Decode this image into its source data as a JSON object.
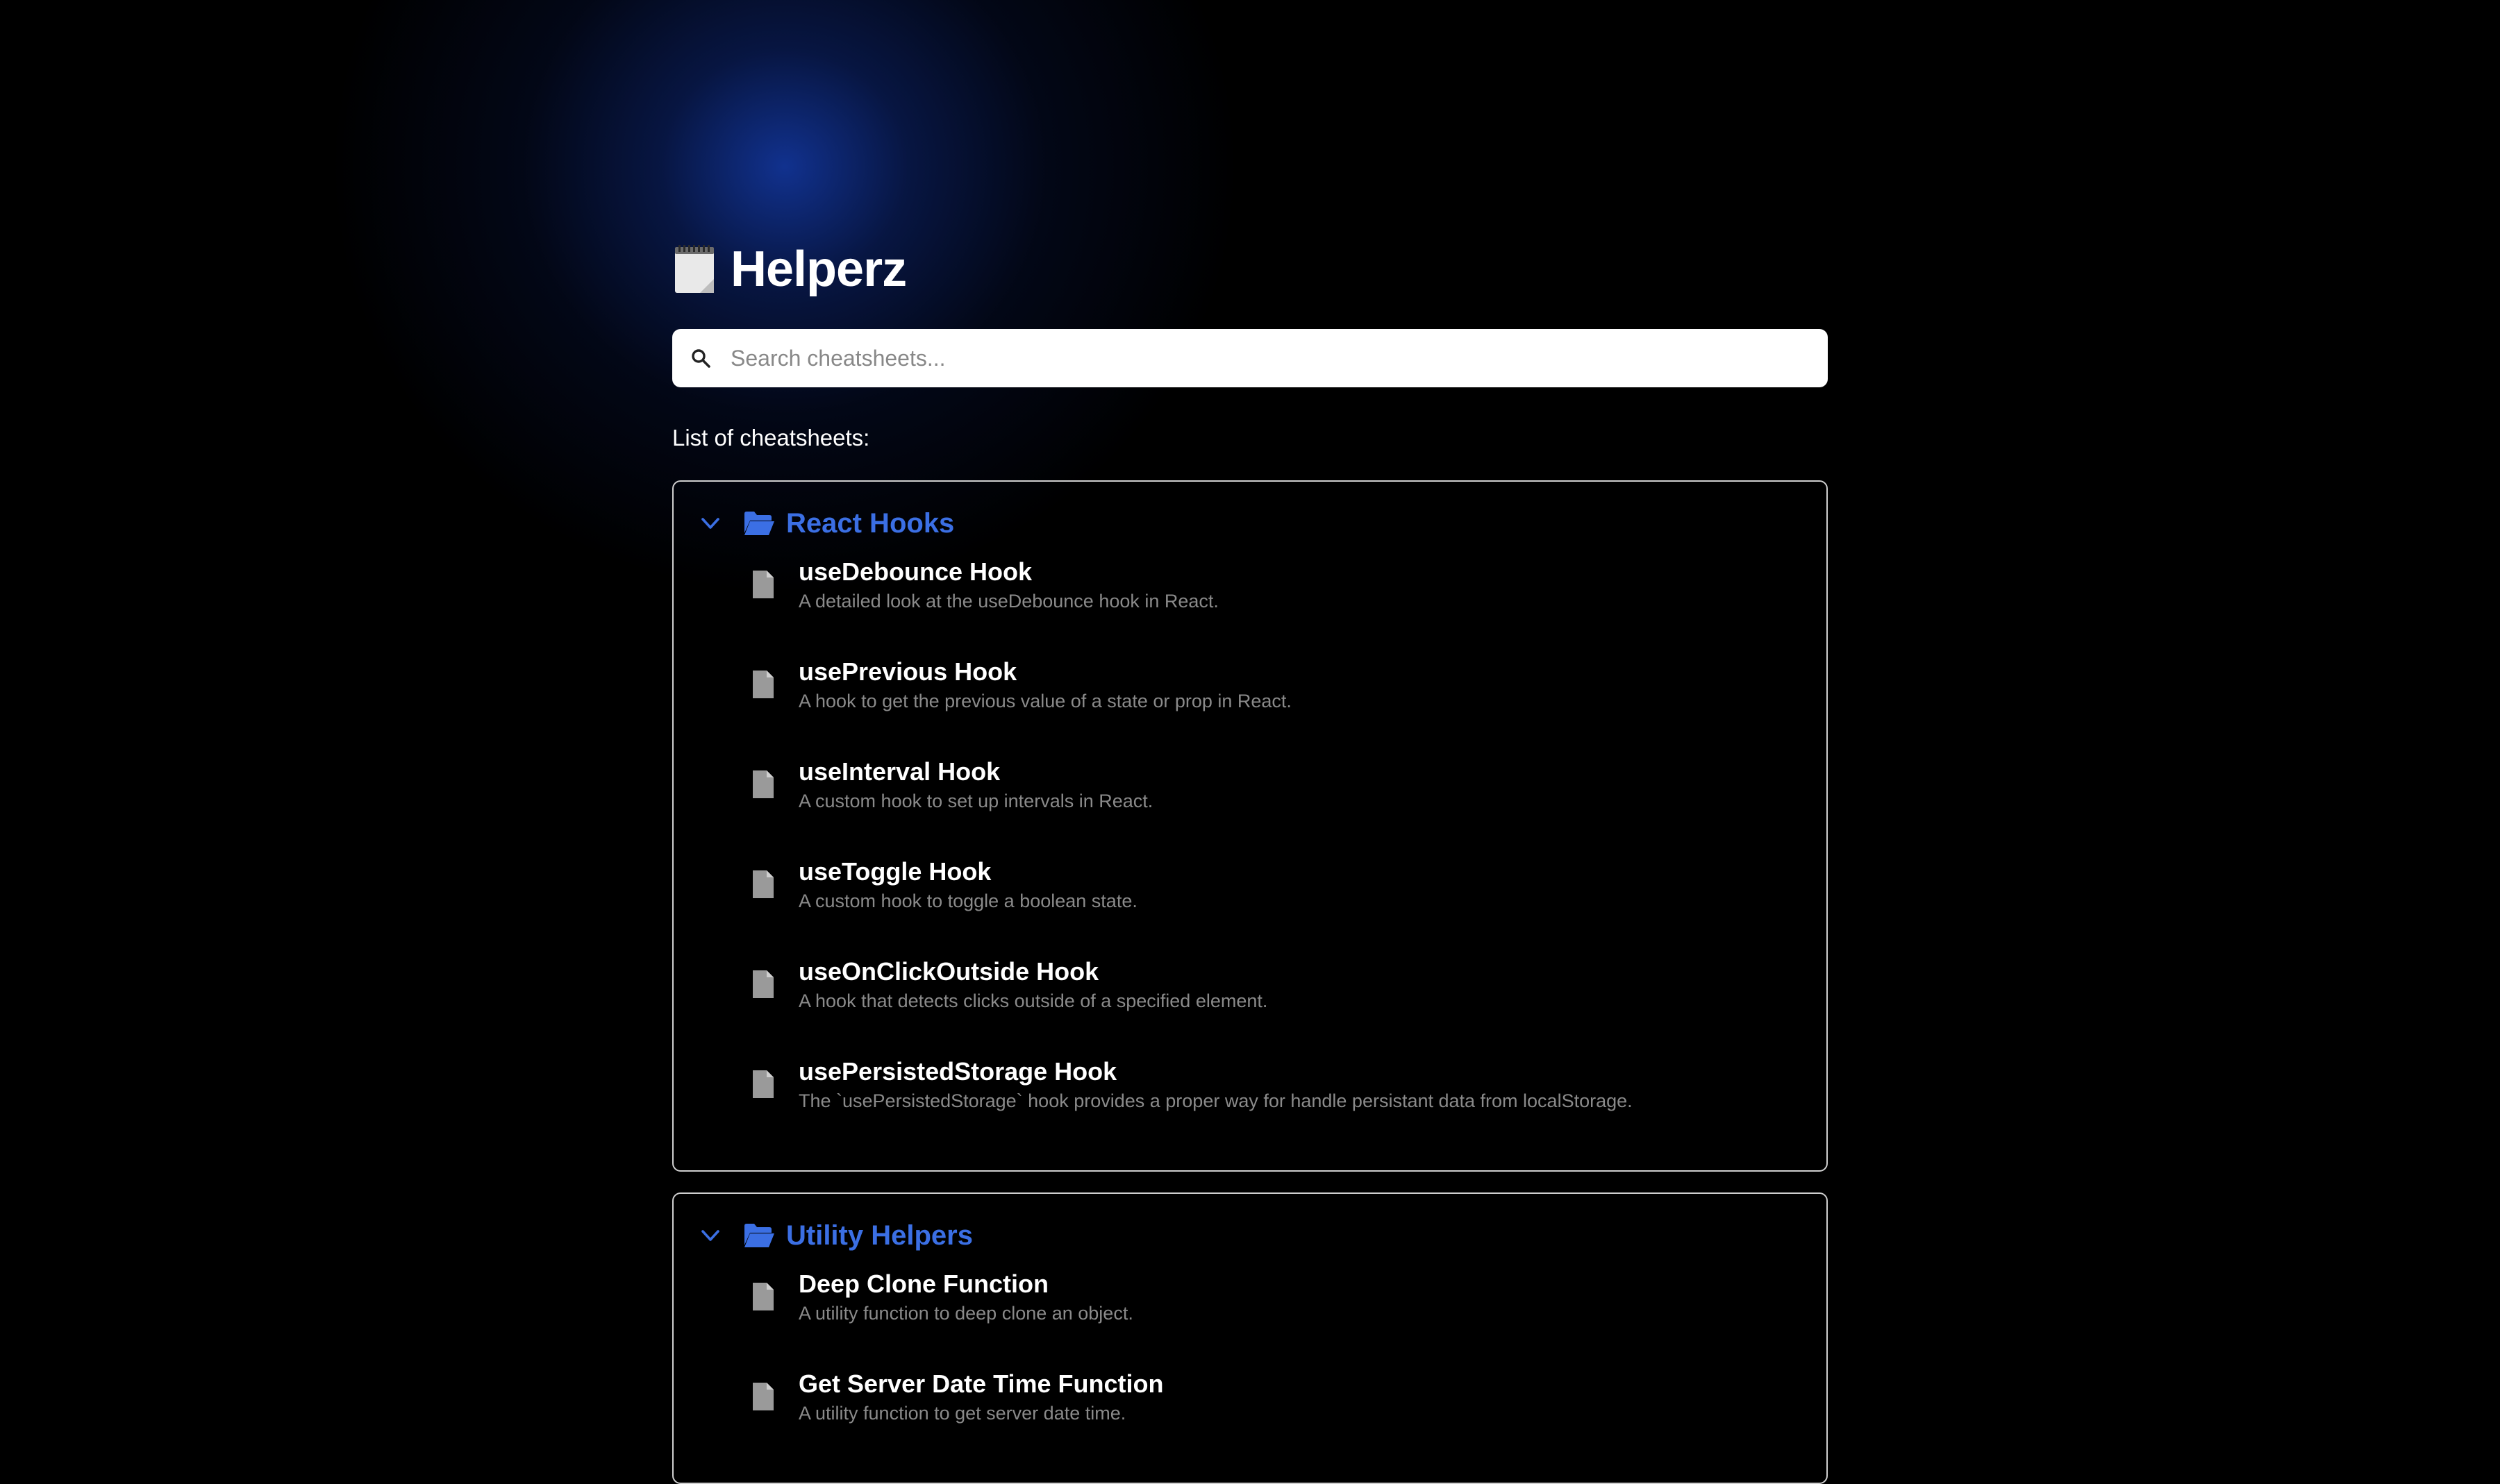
{
  "app": {
    "title": "Helperz",
    "logo_icon": "notepad-icon"
  },
  "search": {
    "placeholder": "Search cheatsheets...",
    "value": "",
    "icon": "search-icon"
  },
  "list_label": "List of cheatsheets:",
  "colors": {
    "background": "#000000",
    "accent": "#3b6fe4",
    "glow": "#12349a",
    "muted_text": "#8a8a8a"
  },
  "groups": [
    {
      "title": "React Hooks",
      "expanded": true,
      "items": [
        {
          "title": "useDebounce Hook",
          "description": "A detailed look at the useDebounce hook in React."
        },
        {
          "title": "usePrevious Hook",
          "description": "A hook to get the previous value of a state or prop in React."
        },
        {
          "title": "useInterval Hook",
          "description": "A custom hook to set up intervals in React."
        },
        {
          "title": "useToggle Hook",
          "description": "A custom hook to toggle a boolean state."
        },
        {
          "title": "useOnClickOutside Hook",
          "description": "A hook that detects clicks outside of a specified element."
        },
        {
          "title": "usePersistedStorage Hook",
          "description": "The `usePersistedStorage` hook provides a proper way for handle persistant data from localStorage."
        }
      ]
    },
    {
      "title": "Utility Helpers",
      "expanded": true,
      "items": [
        {
          "title": "Deep Clone Function",
          "description": "A utility function to deep clone an object."
        },
        {
          "title": "Get Server Date Time Function",
          "description": "A utility function to get server date time."
        }
      ]
    }
  ]
}
